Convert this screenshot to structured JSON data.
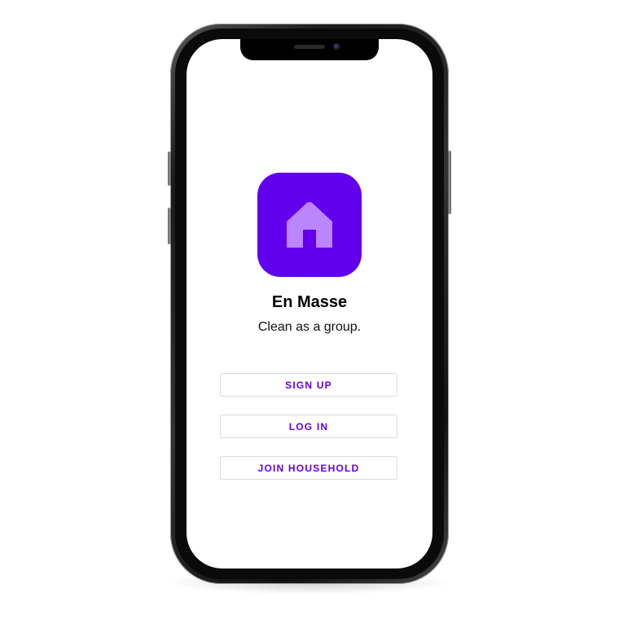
{
  "app": {
    "title": "En Masse",
    "tagline": "Clean as a group.",
    "icon": "home-icon",
    "icon_bg_color": "#6200ee",
    "icon_fg_color": "#bb86fc"
  },
  "buttons": {
    "sign_up": "SIGN UP",
    "log_in": "LOG IN",
    "join_household": "JOIN HOUSEHOLD"
  },
  "colors": {
    "accent": "#6200ee",
    "button_border": "#dcdcdc",
    "screen_bg": "#ffffff"
  }
}
